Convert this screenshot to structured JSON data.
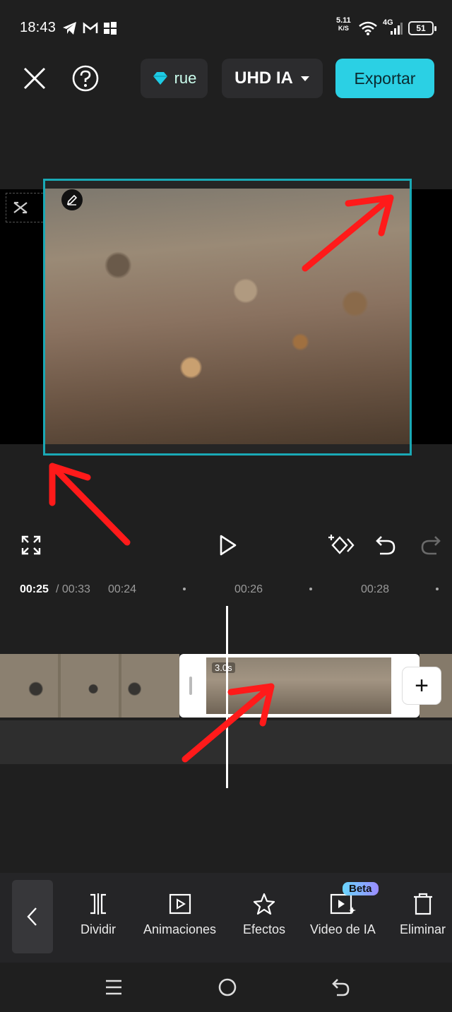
{
  "status_bar": {
    "time": "18:43",
    "net_speed_value": "5.11",
    "net_speed_unit": "K/S",
    "network_type": "4G",
    "battery": "51"
  },
  "toolbar": {
    "pro_label": "rue",
    "quality_label": "UHD IA",
    "export_label": "Exportar"
  },
  "timeline": {
    "current_time": "00:25",
    "total_time": "/ 00:33",
    "ticks": [
      "00:24",
      "00:26",
      "00:28"
    ],
    "clip_duration": "3.0s",
    "add_label": "+"
  },
  "tools": [
    {
      "label": "Dividir",
      "icon": "split-icon"
    },
    {
      "label": "Animaciones",
      "icon": "animation-icon"
    },
    {
      "label": "Efectos",
      "icon": "effects-icon"
    },
    {
      "label": "Video de IA",
      "icon": "ai-video-icon"
    },
    {
      "label": "Eliminar",
      "icon": "delete-icon"
    }
  ],
  "beta_label": "Beta",
  "colors": {
    "accent": "#2bd0e4",
    "selection_border": "#1aa9b5",
    "annotation_arrow": "#ff1a1a",
    "background": "#1f1f1f"
  }
}
